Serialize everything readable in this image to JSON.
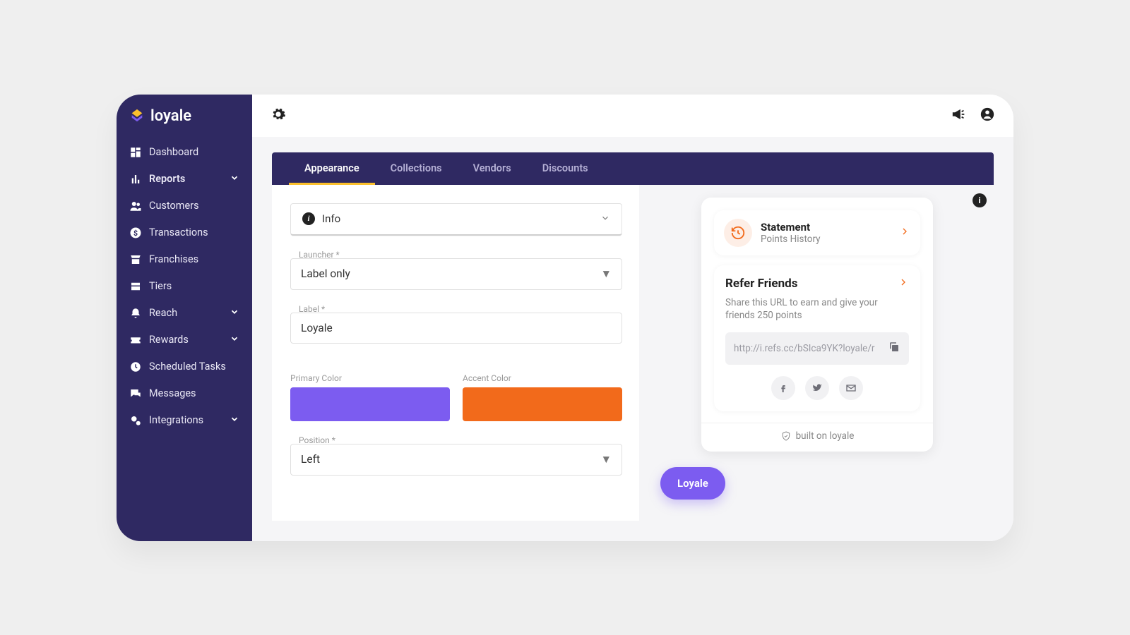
{
  "brand": {
    "name": "loyale"
  },
  "sidebar": {
    "items": [
      {
        "label": "Dashboard"
      },
      {
        "label": "Reports"
      },
      {
        "label": "Customers"
      },
      {
        "label": "Transactions"
      },
      {
        "label": "Franchises"
      },
      {
        "label": "Tiers"
      },
      {
        "label": "Reach"
      },
      {
        "label": "Rewards"
      },
      {
        "label": "Scheduled Tasks"
      },
      {
        "label": "Messages"
      },
      {
        "label": "Integrations"
      }
    ]
  },
  "tabs": [
    {
      "label": "Appearance"
    },
    {
      "label": "Collections"
    },
    {
      "label": "Vendors"
    },
    {
      "label": "Discounts"
    }
  ],
  "form": {
    "info_label": "Info",
    "launcher_label": "Launcher *",
    "launcher_value": "Label only",
    "label_label": "Label *",
    "label_value": "Loyale",
    "primary_label": "Primary Color",
    "primary_value": "#7c5cf0",
    "accent_label": "Accent Color",
    "accent_value": "#f26a1b",
    "position_label": "Position *",
    "position_value": "Left"
  },
  "preview": {
    "statement": {
      "title": "Statement",
      "subtitle": "Points History"
    },
    "refer": {
      "title": "Refer Friends",
      "desc": "Share this URL to earn and give your friends 250 points",
      "url": "http://i.refs.cc/bSIca9YK?loyale/r"
    },
    "built": "built on loyale",
    "launcher_button": "Loyale"
  }
}
